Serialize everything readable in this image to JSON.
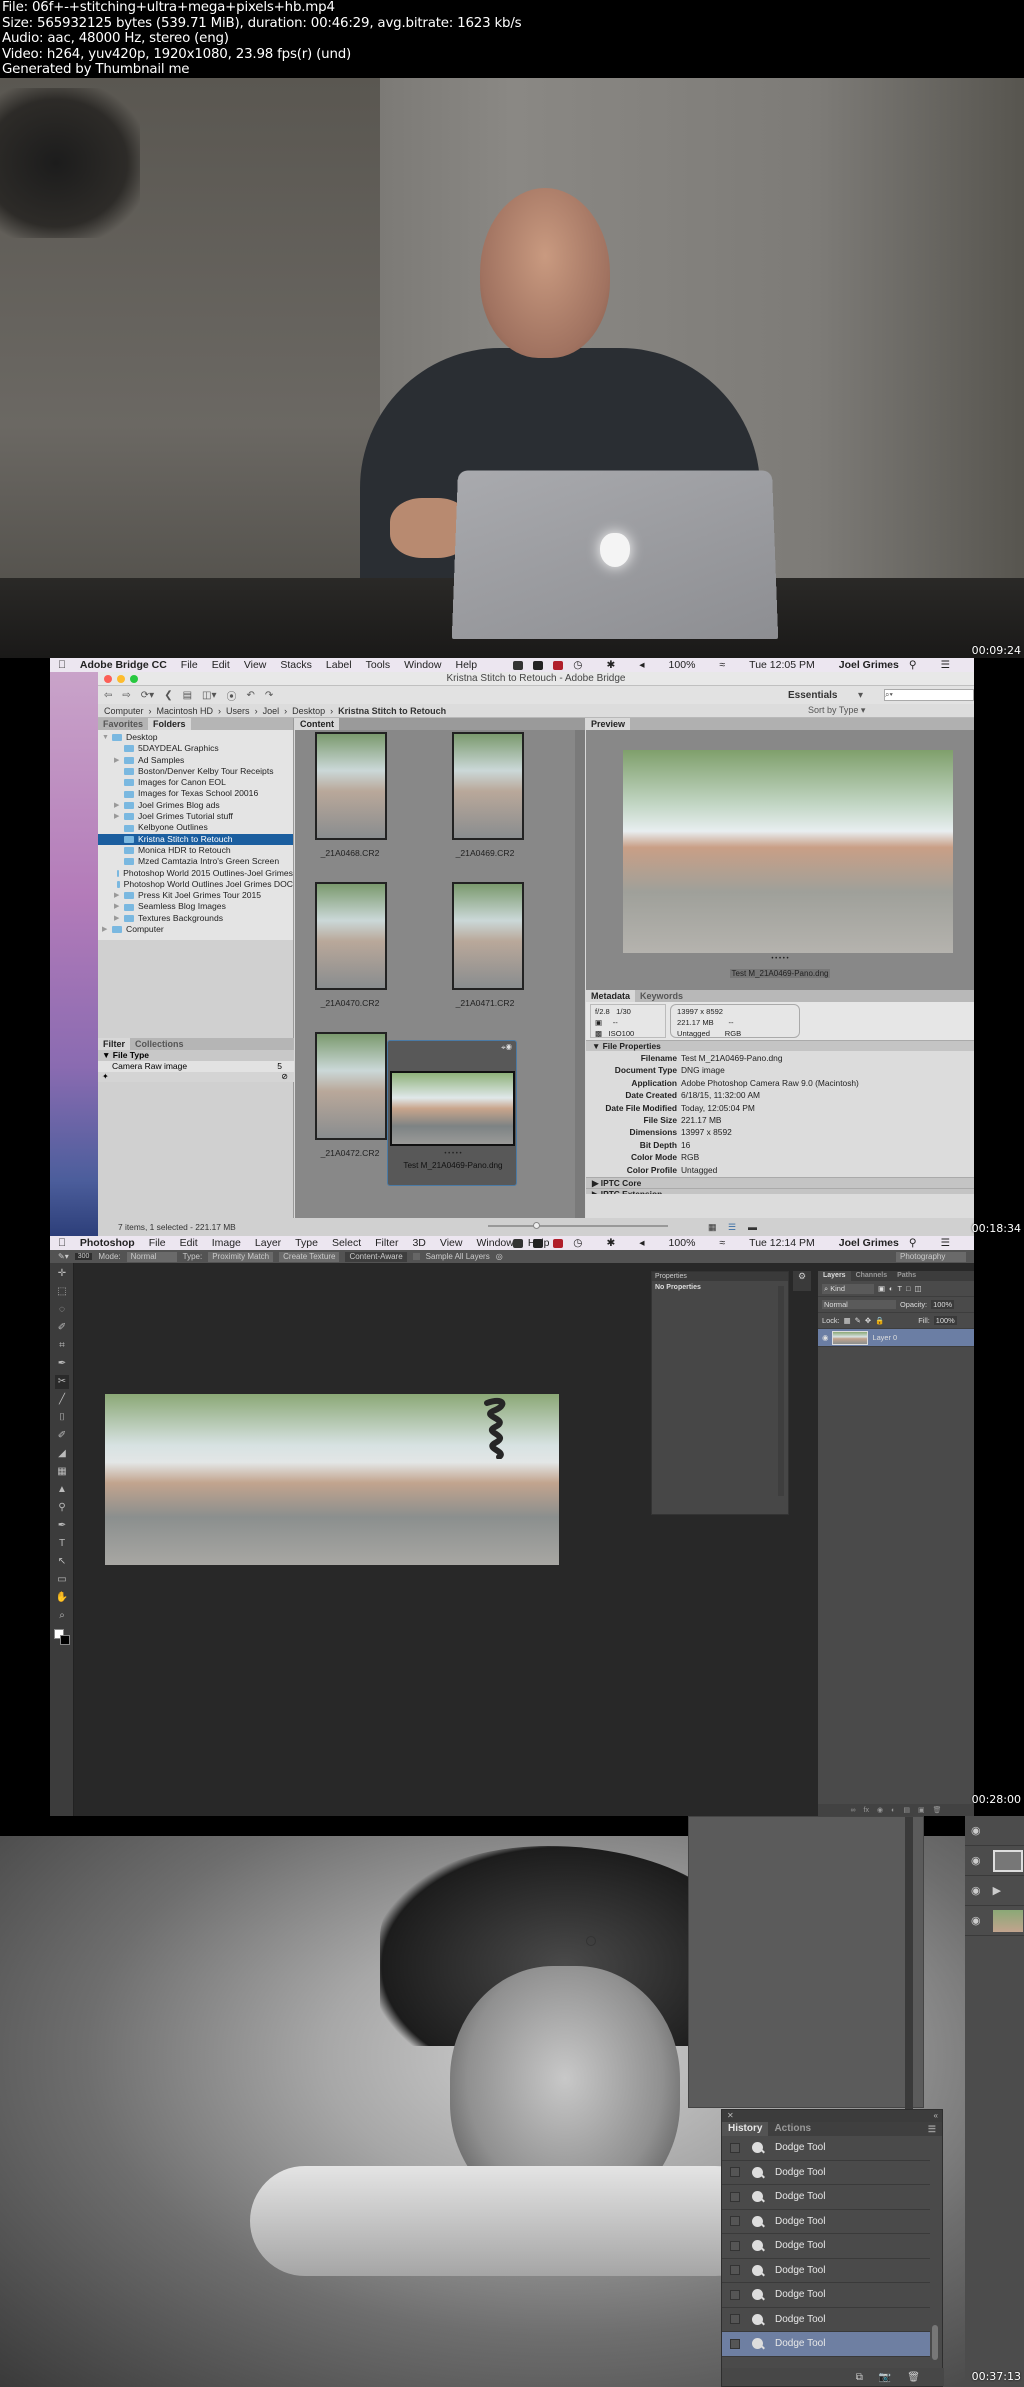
{
  "header": {
    "lines": [
      "File: 06f+-+stitching+ultra+mega+pixels+hb.mp4",
      "Size: 565932125 bytes (539.71 MiB), duration: 00:46:29, avg.bitrate: 1623 kb/s",
      "Audio: aac, 48000 Hz, stereo (eng)",
      "Video: h264, yuv420p, 1920x1080, 23.98 fps(r) (und)",
      "Generated by Thumbnail me"
    ]
  },
  "frames": [
    {
      "timestamp": "00:09:24"
    },
    {
      "timestamp": "00:18:34"
    },
    {
      "timestamp": "00:28:00"
    },
    {
      "timestamp": "00:37:13"
    }
  ],
  "bridge": {
    "menubar": {
      "app": "Adobe Bridge CC",
      "items": [
        "File",
        "Edit",
        "View",
        "Stacks",
        "Label",
        "Tools",
        "Window",
        "Help"
      ],
      "battery": "100%",
      "clock": "Tue 12:05 PM",
      "user": "Joel Grimes"
    },
    "window_title": "Kristna Stitch to Retouch - Adobe Bridge",
    "workspace": "Essentials",
    "search_placeholder": "⌕▾",
    "sort_label": "Sort by Type ▾",
    "breadcrumb": [
      "Computer",
      "Macintosh HD",
      "Users",
      "Joel",
      "Desktop",
      "Kristna Stitch to Retouch"
    ],
    "left_tabs": [
      "Favorites",
      "Folders"
    ],
    "folders": [
      {
        "label": "Desktop",
        "expand": "▼",
        "indent": 0
      },
      {
        "label": "5DAYDEAL Graphics",
        "expand": "",
        "indent": 1
      },
      {
        "label": "Ad Samples",
        "expand": "▶",
        "indent": 1
      },
      {
        "label": "Boston/Denver Kelby Tour Receipts",
        "expand": "",
        "indent": 1
      },
      {
        "label": "Images for Canon EOL",
        "expand": "",
        "indent": 1
      },
      {
        "label": "Images for Texas School 20016",
        "expand": "",
        "indent": 1
      },
      {
        "label": "Joel Grimes Blog ads",
        "expand": "▶",
        "indent": 1
      },
      {
        "label": "Joel Grimes Tutorial stuff",
        "expand": "▶",
        "indent": 1
      },
      {
        "label": "Kelbyone Outlines",
        "expand": "",
        "indent": 1
      },
      {
        "label": "Kristna Stitch to Retouch",
        "expand": "",
        "indent": 1,
        "selected": true
      },
      {
        "label": "Monica HDR to Retouch",
        "expand": "",
        "indent": 1
      },
      {
        "label": "Mzed Camtazia Intro's Green Screen",
        "expand": "",
        "indent": 1
      },
      {
        "label": "Photoshop World 2015 Outlines-Joel Grimes",
        "expand": "",
        "indent": 1
      },
      {
        "label": "Photoshop World Outlines Joel Grimes DOC",
        "expand": "",
        "indent": 1
      },
      {
        "label": "Press Kit Joel Grimes Tour 2015",
        "expand": "▶",
        "indent": 1
      },
      {
        "label": "Seamless Blog Images",
        "expand": "▶",
        "indent": 1
      },
      {
        "label": "Textures Backgrounds",
        "expand": "▶",
        "indent": 1
      },
      {
        "label": "Computer",
        "expand": "▶",
        "indent": 0
      }
    ],
    "filter_tabs": [
      "Filter",
      "Collections"
    ],
    "filter_section": "File Type",
    "filter_item": {
      "label": "Camera Raw image",
      "count": "5"
    },
    "content_tab": "Content",
    "thumbnails": [
      {
        "name": "_21A0468.CR2"
      },
      {
        "name": "_21A0469.CR2"
      },
      {
        "name": "_21A0470.CR2"
      },
      {
        "name": "_21A0471.CR2"
      },
      {
        "name": "_21A0472.CR2"
      },
      {
        "name": "Test M_21A0469-Pano.dng",
        "selected": true
      }
    ],
    "preview_tab": "Preview",
    "preview_caption": "Test M_21A0469-Pano.dng",
    "rating_dots": "• • • • •",
    "meta_tabs": [
      "Metadata",
      "Keywords"
    ],
    "placard": {
      "aperture": "f/2.8",
      "shutter": "1/30",
      "metering": "--",
      "iso": "ISO100",
      "dimensions": "13997 x 8592",
      "size": "221.17 MB",
      "resolution": "--",
      "profile": "Untagged",
      "mode": "RGB"
    },
    "file_properties_title": "File Properties",
    "file_properties": [
      {
        "k": "Filename",
        "v": "Test M_21A0469-Pano.dng"
      },
      {
        "k": "Document Type",
        "v": "DNG image"
      },
      {
        "k": "Application",
        "v": "Adobe Photoshop Camera Raw 9.0 (Macintosh)"
      },
      {
        "k": "Date Created",
        "v": "6/18/15, 11:32:00 AM"
      },
      {
        "k": "Date File Modified",
        "v": "Today, 12:05:04 PM"
      },
      {
        "k": "File Size",
        "v": "221.17 MB"
      },
      {
        "k": "Dimensions",
        "v": "13997 x 8592"
      },
      {
        "k": "Bit Depth",
        "v": "16"
      },
      {
        "k": "Color Mode",
        "v": "RGB"
      },
      {
        "k": "Color Profile",
        "v": "Untagged"
      }
    ],
    "collapsed_sections": [
      "IPTC Core",
      "IPTC Extension"
    ],
    "status": "7 items, 1 selected - 221.17 MB",
    "thumb_size_slider": 0.25
  },
  "photoshop": {
    "menubar": {
      "app": "Photoshop",
      "items": [
        "File",
        "Edit",
        "Image",
        "Layer",
        "Type",
        "Select",
        "Filter",
        "3D",
        "View",
        "Window",
        "Help"
      ],
      "battery": "100%",
      "clock": "Tue 12:14 PM",
      "user": "Joel Grimes"
    },
    "options": {
      "brush_size": "300",
      "mode_label": "Mode:",
      "mode_value": "Normal",
      "type_label": "Type:",
      "type_options": [
        "Proximity Match",
        "Create Texture",
        "Content-Aware"
      ],
      "sample_all": "Sample All Layers",
      "workspace": "Photography"
    },
    "tools": [
      "✛",
      "⬚",
      "◌",
      "✐",
      "⌗",
      "✒",
      "✂",
      "╱",
      "⌷",
      "✐",
      "◢",
      "▦",
      "▲",
      "⚲",
      "✒",
      "T",
      "↖",
      "▭",
      "✋",
      "⌕"
    ],
    "properties": {
      "title": "Properties",
      "content": "No Properties"
    },
    "layers": {
      "tabs": [
        "Layers",
        "Channels",
        "Paths"
      ],
      "kind": "⌕ Kind",
      "blend": "Normal",
      "opacity_label": "Opacity:",
      "opacity": "100%",
      "lock_label": "Lock:",
      "fill_label": "Fill:",
      "fill": "100%",
      "items": [
        {
          "name": "Layer 0"
        }
      ]
    },
    "history": {
      "tabs": [
        "History",
        "Actions"
      ],
      "items": [
        "Dodge Tool",
        "Dodge Tool",
        "Dodge Tool",
        "Dodge Tool",
        "Dodge Tool",
        "Dodge Tool",
        "Dodge Tool",
        "Dodge Tool",
        "Dodge Tool"
      ],
      "selected_index": 8
    }
  }
}
